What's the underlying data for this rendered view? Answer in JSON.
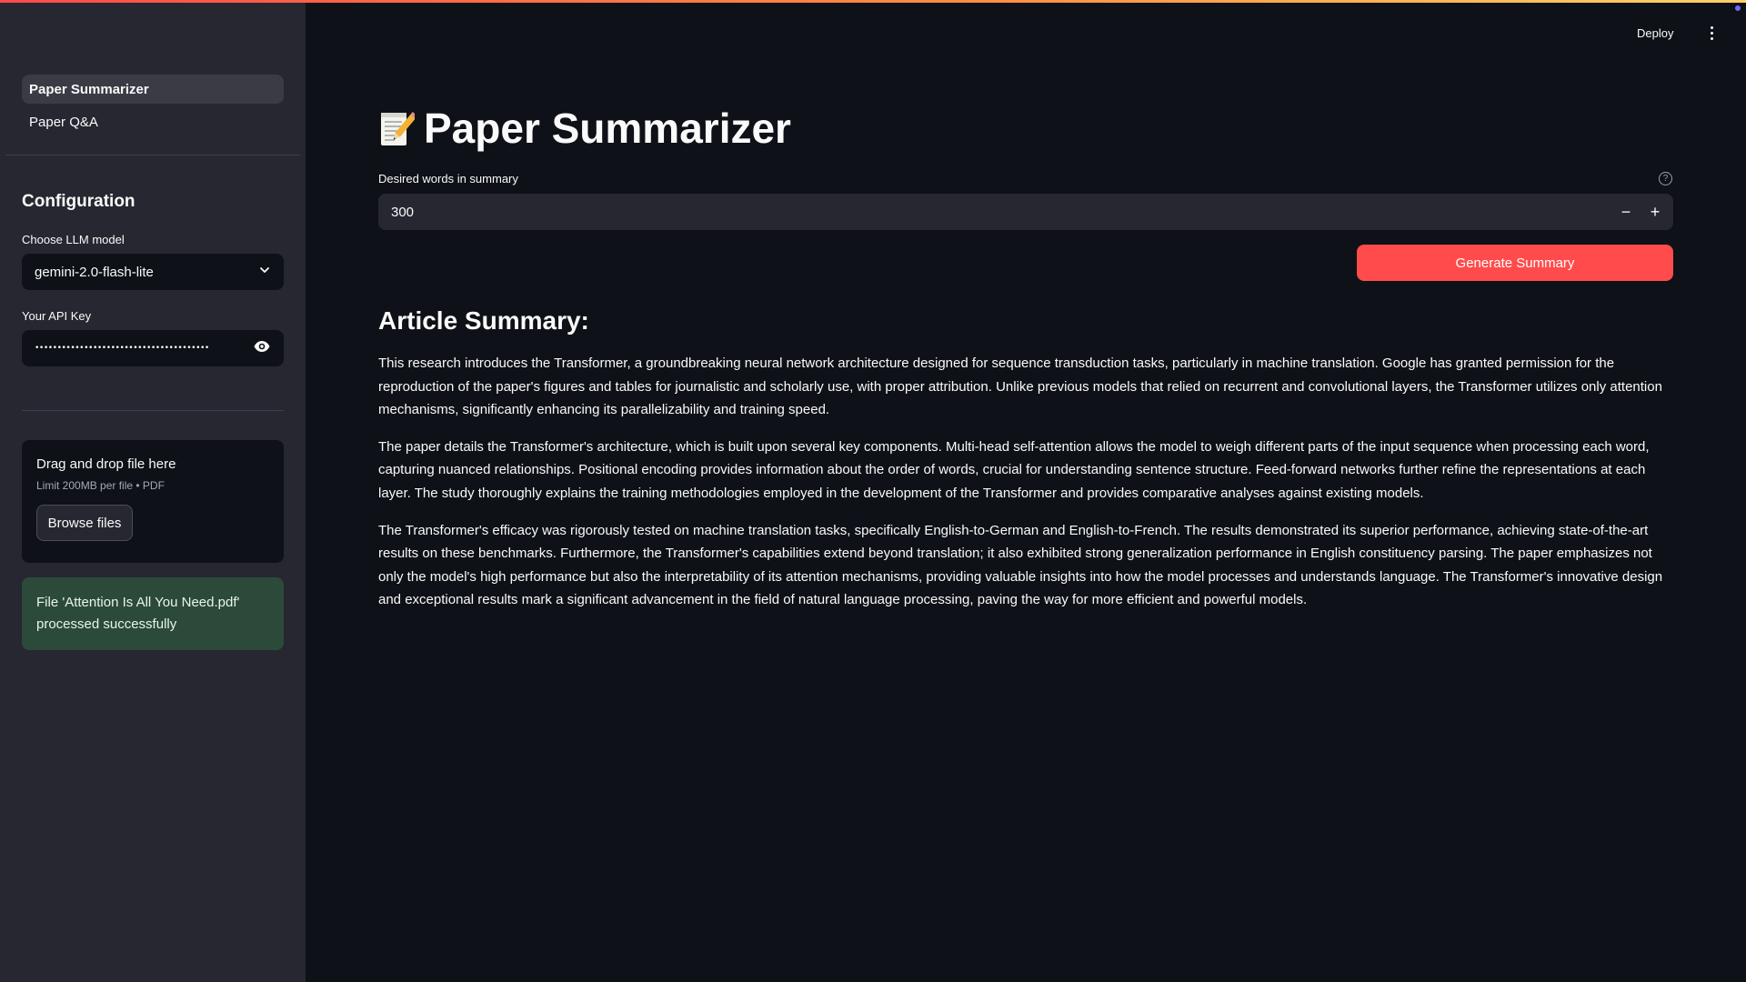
{
  "nav": {
    "items": [
      {
        "label": "Paper Summarizer",
        "active": true
      },
      {
        "label": "Paper Q&A",
        "active": false
      }
    ]
  },
  "sidebar": {
    "config_title": "Configuration",
    "model_label": "Choose LLM model",
    "model_value": "gemini-2.0-flash-lite",
    "api_label": "Your API Key",
    "api_value": "•••••••••••••••••••••••••••••••••••••••"
  },
  "uploader": {
    "title": "Drag and drop file here",
    "subtitle": "Limit 200MB per file • PDF",
    "browse_label": "Browse files"
  },
  "success_message": "File 'Attention Is All You Need.pdf' processed successfully",
  "header": {
    "deploy_label": "Deploy"
  },
  "main": {
    "title": "Paper Summarizer",
    "words_label": "Desired words in summary",
    "words_value": "300",
    "minus": "−",
    "plus": "+",
    "help": "?",
    "generate_label": "Generate Summary",
    "summary_title": "Article Summary:",
    "paragraphs": [
      "This research introduces the Transformer, a groundbreaking neural network architecture designed for sequence transduction tasks, particularly in machine translation. Google has granted permission for the reproduction of the paper's figures and tables for journalistic and scholarly use, with proper attribution. Unlike previous models that relied on recurrent and convolutional layers, the Transformer utilizes only attention mechanisms, significantly enhancing its parallelizability and training speed.",
      "The paper details the Transformer's architecture, which is built upon several key components. Multi-head self-attention allows the model to weigh different parts of the input sequence when processing each word, capturing nuanced relationships. Positional encoding provides information about the order of words, crucial for understanding sentence structure. Feed-forward networks further refine the representations at each layer. The study thoroughly explains the training methodologies employed in the development of the Transformer and provides comparative analyses against existing models.",
      "The Transformer's efficacy was rigorously tested on machine translation tasks, specifically English-to-German and English-to-French. The results demonstrated its superior performance, achieving state-of-the-art results on these benchmarks. Furthermore, the Transformer's capabilities extend beyond translation; it also exhibited strong generalization performance in English constituency parsing. The paper emphasizes not only the model's high performance but also the interpretability of its attention mechanisms, providing valuable insights into how the model processes and understands language. The Transformer's innovative design and exceptional results mark a significant advancement in the field of natural language processing, paving the way for more efficient and powerful models."
    ]
  },
  "colors": {
    "accent": "#ff4b4b",
    "app_bg": "#0e1117",
    "sidebar_bg": "#262730",
    "success_bg": "#2c4a3a"
  },
  "icons": {
    "title_icon": "memo-icon",
    "select": "chevron-down-icon",
    "password": "eye-icon",
    "help": "help-circle-icon",
    "menu": "kebab-menu-icon"
  }
}
